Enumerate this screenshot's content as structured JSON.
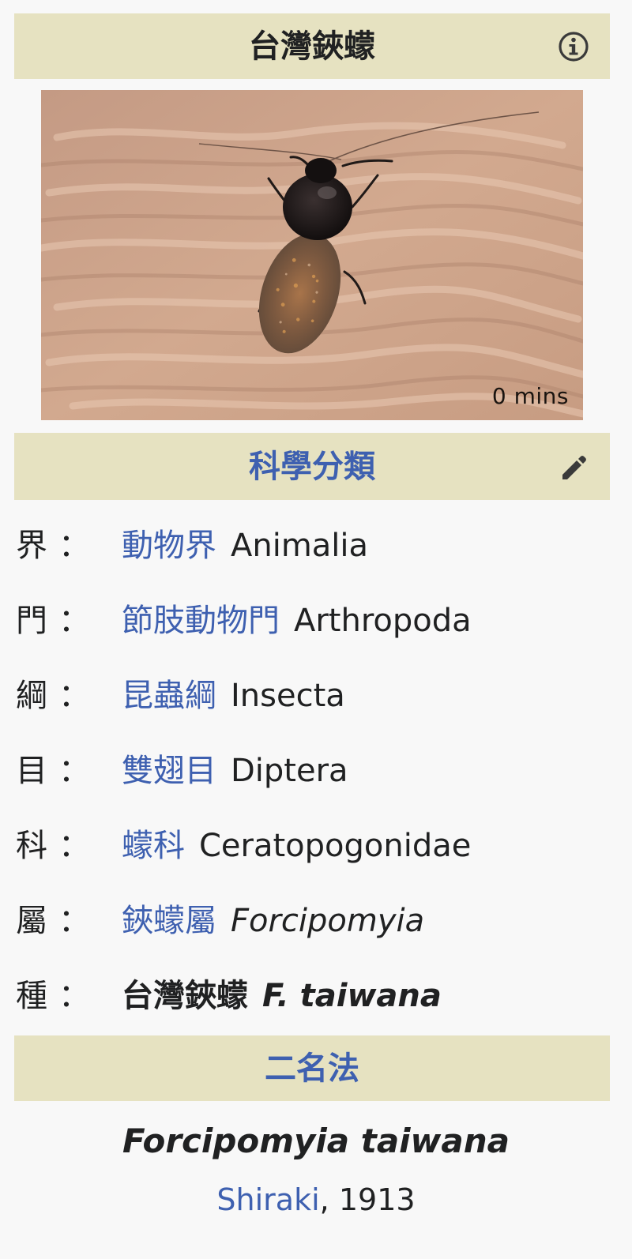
{
  "header": {
    "title": "台灣鋏蠓"
  },
  "image": {
    "caption": "0 mins"
  },
  "scientific_classification": {
    "title": "科學分類",
    "ranks": [
      {
        "rank": "界",
        "colon": "：",
        "zh": "動物界",
        "latin": "Animalia"
      },
      {
        "rank": "門",
        "colon": "：",
        "zh": "節肢動物門",
        "latin": "Arthropoda"
      },
      {
        "rank": "綱",
        "colon": "：",
        "zh": "昆蟲綱",
        "latin": "Insecta"
      },
      {
        "rank": "目",
        "colon": "：",
        "zh": "雙翅目",
        "latin": "Diptera"
      },
      {
        "rank": "科",
        "colon": "：",
        "zh": "蠓科",
        "latin": "Ceratopogonidae"
      },
      {
        "rank": "屬",
        "colon": "：",
        "zh": "鋏蠓屬",
        "latin": "Forcipomyia"
      },
      {
        "rank": "種",
        "colon": "：",
        "zh": "台灣鋏蠓",
        "latin": "F. taiwana"
      }
    ]
  },
  "binomial": {
    "title": "二名法",
    "name": "Forcipomyia taiwana",
    "author": "Shiraki",
    "separator": ", ",
    "year": "1913"
  },
  "colors": {
    "header_bg": "#e6e2c1",
    "link": "#3e60b0",
    "text": "#202122",
    "page_bg": "#f8f8f8"
  },
  "icons": {
    "header": "info-icon",
    "classification": "edit-pencil-icon"
  }
}
